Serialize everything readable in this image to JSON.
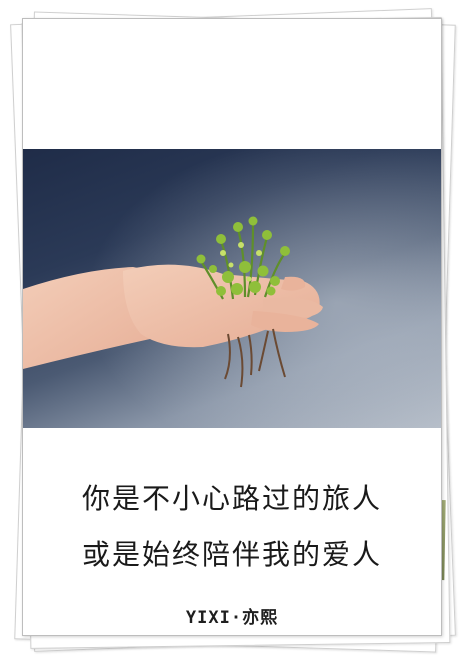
{
  "caption": {
    "line1": "你是不小心路过的旅人",
    "line2": "或是始终陪伴我的爱人"
  },
  "signature": {
    "text": "YIXI·亦熙"
  },
  "photo": {
    "subject": "hand-holding-seedling",
    "colors": {
      "background_dark": "#1f2c48",
      "background_light": "#b5bdc8",
      "skin": "#f1c7b2",
      "plant": "#8fbf3a"
    }
  }
}
